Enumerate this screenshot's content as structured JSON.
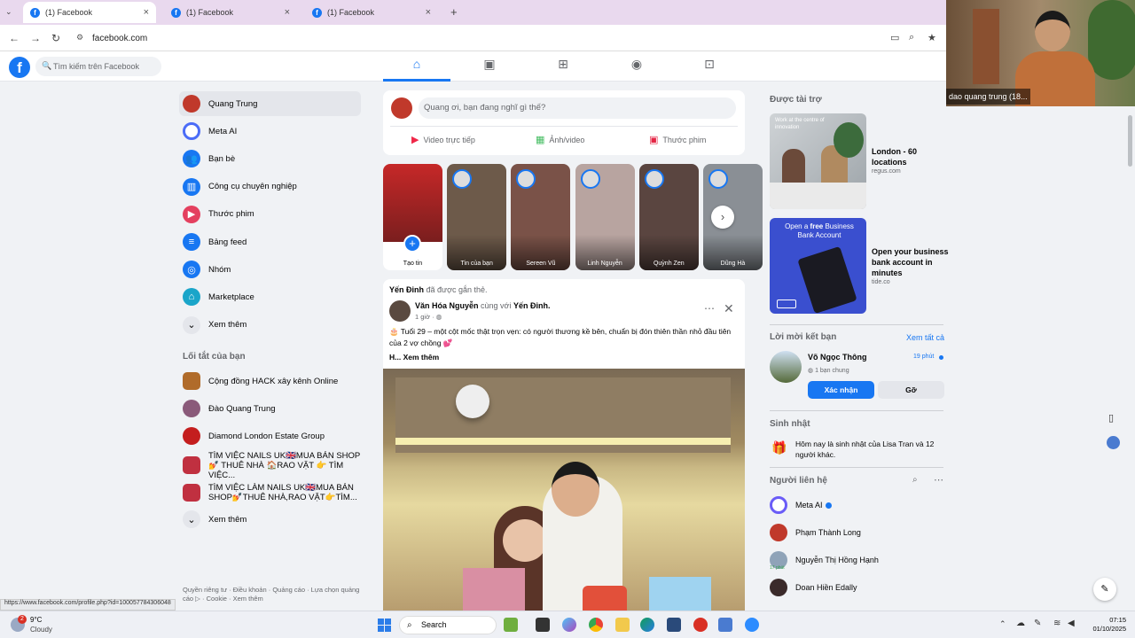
{
  "browser": {
    "tabs": [
      {
        "title": "(1) Facebook",
        "active": true
      },
      {
        "title": "(1) Facebook",
        "active": false
      },
      {
        "title": "(1) Facebook",
        "active": false
      }
    ],
    "url": "facebook.com",
    "status_url": "https://www.facebook.com/profile.php?id=100057784306048"
  },
  "header": {
    "logo": "f",
    "search_placeholder": "Tìm kiếm trên Facebook"
  },
  "sidebar": {
    "items": [
      {
        "label": "Quang Trung",
        "icon": "profile-avatar",
        "color": "#c0392b"
      },
      {
        "label": "Meta AI",
        "icon": "meta-ai-ring",
        "color": "#4b6cf7"
      },
      {
        "label": "Bạn bè",
        "icon": "friends-icon",
        "color": "#1877f2"
      },
      {
        "label": "Công cụ chuyên nghiệp",
        "icon": "pro-tools-icon",
        "color": "#1877f2"
      },
      {
        "label": "Thước phim",
        "icon": "reels-icon",
        "color": "#e4405f"
      },
      {
        "label": "Bảng feed",
        "icon": "feed-icon",
        "color": "#1877f2"
      },
      {
        "label": "Nhóm",
        "icon": "groups-icon",
        "color": "#1877f2"
      },
      {
        "label": "Marketplace",
        "icon": "marketplace-icon",
        "color": "#1aa5c9"
      },
      {
        "label": "Xem thêm",
        "icon": "chevron-down-icon",
        "color": "#e4e6eb"
      }
    ],
    "shortcuts_title": "Lối tắt của bạn",
    "shortcuts": [
      {
        "label": "Cộng đồng HACK xây kênh Online",
        "color": "#b06b2a"
      },
      {
        "label": "Đào Quang Trung",
        "color": "#8a5a7a"
      },
      {
        "label": "Diamond London Estate Group",
        "color": "#c41e1e"
      },
      {
        "label": "TÌM VIỆC NAILS UK🇬🇧MUA BÁN SHOP 💅 THUÊ NHÀ 🏠RAO VẶT 👉 TÌM VIỆC...",
        "color": "#c03040"
      },
      {
        "label": "TÌM VIỆC LÀM NAILS UK🇬🇧MUA BÁN SHOP💅THUÊ NHÀ,RAO VẶT👉TÌM...",
        "color": "#c03040"
      }
    ],
    "shortcuts_more": "Xem thêm",
    "footer": "Quyền riêng tư · Điều khoản · Quảng cáo · Lựa chọn quảng cáo ▷ · Cookie · Xem thêm"
  },
  "composer": {
    "placeholder": "Quang ơi, bạn đang nghĩ gì thế?",
    "actions": [
      {
        "label": "Video trực tiếp",
        "color": "#f02849"
      },
      {
        "label": "Ảnh/video",
        "color": "#45bd62"
      },
      {
        "label": "Thước phim",
        "color": "#e42645"
      }
    ]
  },
  "stories": [
    {
      "label": "Tạo tin",
      "color": "#b22222"
    },
    {
      "label": "Tin của bạn",
      "color": "#6d5a4a"
    },
    {
      "label": "Sereen Vũ",
      "color": "#7a5248"
    },
    {
      "label": "Linh Nguyễn",
      "color": "#b8a4a0"
    },
    {
      "label": "Quỳnh Zen",
      "color": "#5a4540"
    },
    {
      "label": "Dũng Hà",
      "color": "#8a8f95"
    }
  ],
  "post": {
    "context_name": "Yến Đinh",
    "context_text": "đã được gắn thẻ.",
    "author": "Văn Hóa Nguyễn",
    "with_text": "cùng với",
    "with_name": "Yến Đinh.",
    "time": "1 giờ · ",
    "text": "🎂 Tuổi 29 – một cột mốc thật trọn vẹn: có người thương kề bên, chuẩn bị đón thiên thần nhỏ đầu tiên của 2 vợ chồng 💕",
    "more": "H... Xem thêm"
  },
  "right": {
    "sponsored_title": "Được tài trợ",
    "ads": [
      {
        "title": "London - 60 locations",
        "domain": "regus.com",
        "image_text": "Work at the centre of innovation",
        "color": "#d8d8d8"
      },
      {
        "title": "Open your business bank account in minutes",
        "domain": "tide.co",
        "image_text_1": "Open a",
        "image_text_bold": "free",
        "image_text_2": "Business Bank Account",
        "color": "#3a4fcf"
      }
    ],
    "friend_requests_title": "Lời mời kết bạn",
    "see_all": "Xem tất cả",
    "request": {
      "name": "Võ Ngọc Thông",
      "time": "19 phút",
      "mutual": "1 bạn chung",
      "confirm": "Xác nhận",
      "delete": "Gỡ"
    },
    "birthday_title": "Sinh nhật",
    "birthday_text": "Hôm nay là sinh nhật của Lisa Tran và 12 người khác.",
    "contacts_title": "Người liên hệ",
    "contacts": [
      {
        "name": "Meta AI",
        "color": "#6a5cf7"
      },
      {
        "name": "Phạm Thành Long",
        "color": "#c0392b"
      },
      {
        "name": "Nguyễn Thị Hồng Hạnh",
        "color": "#8fa3b8",
        "badge": "17 phút"
      },
      {
        "name": "Doan Hiền Edally",
        "color": "#3a2a2a"
      }
    ]
  },
  "webcam": {
    "label": "dao quang trung (18..."
  },
  "taskbar": {
    "weather_temp": "9°C",
    "weather_text": "Cloudy",
    "weather_badge": "2",
    "search": "Search",
    "time": "07:15",
    "date": "01/10/2025"
  }
}
